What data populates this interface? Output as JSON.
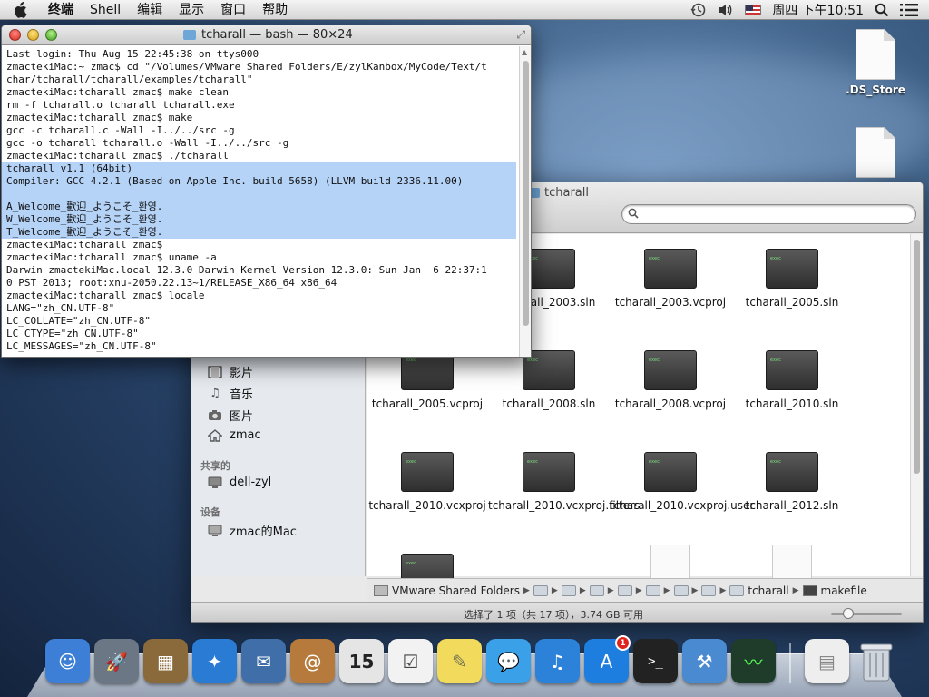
{
  "menubar": {
    "items": [
      "终端",
      "Shell",
      "编辑",
      "显示",
      "窗口",
      "帮助"
    ],
    "clock": "周四 下午10:51"
  },
  "desktop": {
    "icons": [
      ".DS_Store",
      ""
    ]
  },
  "terminal": {
    "title": "tcharall — bash — 80×24",
    "lines": [
      {
        "text": "Last login: Thu Aug 15 22:45:38 on ttys000",
        "hl": false
      },
      {
        "text": "zmactekiMac:~ zmac$ cd \"/Volumes/VMware Shared Folders/E/zylKanbox/MyCode/Text/t",
        "hl": false
      },
      {
        "text": "char/tcharall/tcharall/examples/tcharall\"",
        "hl": false
      },
      {
        "text": "zmactekiMac:tcharall zmac$ make clean",
        "hl": false
      },
      {
        "text": "rm -f tcharall.o tcharall tcharall.exe",
        "hl": false
      },
      {
        "text": "zmactekiMac:tcharall zmac$ make",
        "hl": false
      },
      {
        "text": "gcc -c tcharall.c -Wall -I../../src -g",
        "hl": false
      },
      {
        "text": "gcc -o tcharall tcharall.o -Wall -I../../src -g",
        "hl": false
      },
      {
        "text": "zmactekiMac:tcharall zmac$ ./tcharall",
        "hl": false
      },
      {
        "text": "tcharall v1.1 (64bit)",
        "hl": true
      },
      {
        "text": "Compiler: GCC 4.2.1 (Based on Apple Inc. build 5658) (LLVM build 2336.11.00)",
        "hl": true
      },
      {
        "text": "",
        "hl": true
      },
      {
        "text": "A_Welcome_歡迎_ようこそ_환영.",
        "hl": true
      },
      {
        "text": "W_Welcome_歡迎_ようこそ_환영.",
        "hl": true
      },
      {
        "text": "T_Welcome_歡迎_ようこそ_환영.",
        "hl": true
      },
      {
        "text": "zmactekiMac:tcharall zmac$",
        "hl": false
      },
      {
        "text": "zmactekiMac:tcharall zmac$ uname -a",
        "hl": false
      },
      {
        "text": "Darwin zmactekiMac.local 12.3.0 Darwin Kernel Version 12.3.0: Sun Jan  6 22:37:1",
        "hl": false
      },
      {
        "text": "0 PST 2013; root:xnu-2050.22.13~1/RELEASE_X86_64 x86_64",
        "hl": false
      },
      {
        "text": "zmactekiMac:tcharall zmac$ locale",
        "hl": false
      },
      {
        "text": "LANG=\"zh_CN.UTF-8\"",
        "hl": false
      },
      {
        "text": "LC_COLLATE=\"zh_CN.UTF-8\"",
        "hl": false
      },
      {
        "text": "LC_CTYPE=\"zh_CN.UTF-8\"",
        "hl": false
      },
      {
        "text": "LC_MESSAGES=\"zh_CN.UTF-8\"",
        "hl": false
      }
    ]
  },
  "finder": {
    "title": "tcharall",
    "sidebar": {
      "favorites": [
        {
          "label": "影片",
          "icon": "film-icon"
        },
        {
          "label": "音乐",
          "icon": "music-icon"
        },
        {
          "label": "图片",
          "icon": "camera-icon"
        },
        {
          "label": "zmac",
          "icon": "home-icon"
        }
      ],
      "shared_header": "共享的",
      "shared": [
        {
          "label": "dell-zyl",
          "icon": "monitor-icon"
        }
      ],
      "devices_header": "设备",
      "devices": [
        {
          "label": "zmac的Mac",
          "icon": "monitor-icon"
        }
      ]
    },
    "files": [
      [
        "",
        "tcharall_2003.sln",
        "tcharall_2003.vcproj",
        "tcharall_2005.sln"
      ],
      [
        "tcharall_2005.vcproj",
        "tcharall_2008.sln",
        "tcharall_2008.vcproj",
        "tcharall_2010.sln"
      ],
      [
        "tcharall_2010.vcxproj",
        "tcharall_2010.vcxproj.filters",
        "tcharall_2010.vcxproj.user",
        "tcharall_2012.sln"
      ]
    ],
    "pathbar": {
      "first": "VMware Shared Folders",
      "current": "tcharall",
      "file": "makefile"
    },
    "status": "选择了 1 项（共 17 项），3.74 GB 可用"
  },
  "dock": {
    "badge": "1",
    "calendar_day": "15",
    "colors": [
      "#3d7fd6",
      "#6b7785",
      "#8a6a3a",
      "#2a7bd4",
      "#3f6ea8",
      "#b57a3c",
      "#e5e5e5",
      "#f2f2f2",
      "#f1da5c",
      "#3aa0e8",
      "#2c82d8",
      "#1e7ee0",
      "#222222",
      "#4a8ad0",
      "#1f3c2a"
    ]
  }
}
